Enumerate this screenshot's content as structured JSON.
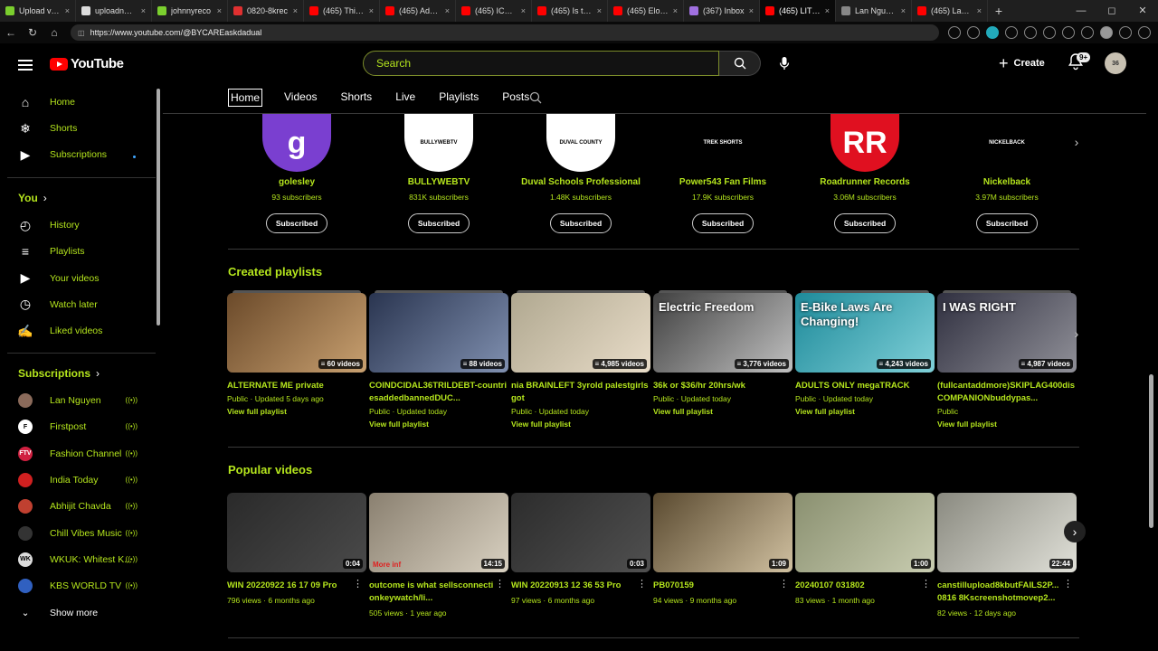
{
  "browser": {
    "tabs": [
      {
        "label": "Upload vide",
        "color": "#7bcf2e"
      },
      {
        "label": "uploadnow-l",
        "color": "#dddddd"
      },
      {
        "label": "johnnyreco",
        "color": "#7bcf2e"
      },
      {
        "label": "0820-8krec",
        "color": "#e03030"
      },
      {
        "label": "(465) This is",
        "color": "#ff0000"
      },
      {
        "label": "(465) Adora",
        "color": "#ff0000"
      },
      {
        "label": "(465) ICE car",
        "color": "#ff0000"
      },
      {
        "label": "(465) Is this",
        "color": "#ff0000"
      },
      {
        "label": "(465) Elon M",
        "color": "#ff0000"
      },
      {
        "label": "(367) Inbox",
        "color": "#a070e0"
      },
      {
        "label": "(465) LITHIU",
        "color": "#ff0000"
      },
      {
        "label": "Lan Nguyen",
        "color": "#888888"
      },
      {
        "label": "(465) Lan Ng",
        "color": "#ff0000"
      }
    ],
    "new_tab": "+",
    "url": "https://www.youtube.com/@BYCAREaskdadual"
  },
  "header": {
    "logo_text": "YouTube",
    "search_placeholder": "Search",
    "create_label": "Create",
    "notifications_badge": "9+",
    "avatar_text": "36"
  },
  "sidebar": {
    "main": [
      {
        "label": "Home",
        "icon": "home-icon"
      },
      {
        "label": "Shorts",
        "icon": "shorts-icon"
      },
      {
        "label": "Subscriptions",
        "icon": "subscriptions-icon"
      }
    ],
    "you_title": "You",
    "you_items": [
      {
        "label": "History",
        "icon": "history-icon"
      },
      {
        "label": "Playlists",
        "icon": "playlists-icon"
      },
      {
        "label": "Your videos",
        "icon": "your-videos-icon"
      },
      {
        "label": "Watch later",
        "icon": "watch-later-icon"
      },
      {
        "label": "Liked videos",
        "icon": "liked-icon"
      }
    ],
    "subscriptions_title": "Subscriptions",
    "subscriptions": [
      {
        "label": "Lan Nguyen",
        "color": "#8a6a5a",
        "initial": ""
      },
      {
        "label": "Firstpost",
        "color": "#ffffff",
        "initial": "F"
      },
      {
        "label": "Fashion Channel",
        "color": "#d02040",
        "initial": "FTV"
      },
      {
        "label": "India Today",
        "color": "#d02020",
        "initial": ""
      },
      {
        "label": "Abhijit Chavda",
        "color": "#c04030",
        "initial": ""
      },
      {
        "label": "Chill Vibes Music",
        "color": "#333333",
        "initial": ""
      },
      {
        "label": "WKUK: Whitest K...",
        "color": "#dddddd",
        "initial": "WK"
      },
      {
        "label": "KBS WORLD TV",
        "color": "#3060c0",
        "initial": ""
      }
    ],
    "show_more": "Show more"
  },
  "channel_tabs": [
    "Home",
    "Videos",
    "Shorts",
    "Live",
    "Playlists",
    "Posts"
  ],
  "channels": [
    {
      "name": "golesley",
      "subs": "93 subscribers",
      "btn": "Subscribed",
      "avatar_text": "g",
      "color": "#7a3fd0"
    },
    {
      "name": "BULLYWEBTV",
      "subs": "831K subscribers",
      "btn": "Subscribed",
      "avatar_text": "BULLYWEBTV",
      "color": "#ffffff"
    },
    {
      "name": "Duval Schools Professional",
      "subs": "1.48K subscribers",
      "btn": "Subscribed",
      "avatar_text": "DUVAL COUNTY",
      "color": "#ffffff"
    },
    {
      "name": "Power543 Fan Films",
      "subs": "17.9K subscribers",
      "btn": "Subscribed",
      "avatar_text": "TREK SHORTS",
      "color": "#000000"
    },
    {
      "name": "Roadrunner Records",
      "subs": "3.06M subscribers",
      "btn": "Subscribed",
      "avatar_text": "RR",
      "color": "#e01020"
    },
    {
      "name": "Nickelback",
      "subs": "3.97M subscribers",
      "btn": "Subscribed",
      "avatar_text": "NICKELBACK",
      "color": "#000000"
    }
  ],
  "created_playlists_title": "Created playlists",
  "playlists": [
    {
      "title": "ALTERNATE ME private",
      "meta": "Public · Updated 5 days ago",
      "count": "60 videos",
      "link": "View full playlist",
      "c1": "#6b4a2a",
      "c2": "#c8a070"
    },
    {
      "title": "COINDCIDAL36TRILDEBT-countriesaddedbannedDUC...",
      "meta": "Public · Updated today",
      "count": "88 videos",
      "link": "View full playlist",
      "c1": "#2a3550",
      "c2": "#8090b0"
    },
    {
      "title": "nia BRAINLEFT 3yrold palestgirlsgot",
      "meta": "Public · Updated today",
      "count": "4,985 videos",
      "link": "View full playlist",
      "c1": "#b0a890",
      "c2": "#e8dcc8"
    },
    {
      "title": "36k or $36/hr 20hrs/wk",
      "meta": "Public · Updated today",
      "count": "3,776 videos",
      "link": "View full playlist",
      "c1": "#404040",
      "c2": "#c0c0c0",
      "overlay": "Electric Freedom"
    },
    {
      "title": "ADULTS ONLY megaTRACK",
      "meta": "Public · Updated today",
      "count": "4,243 videos",
      "link": "View full playlist",
      "c1": "#1e8a9a",
      "c2": "#7fd0d8",
      "overlay": "E-Bike Laws Are Changing!"
    },
    {
      "title": "(fullcantaddmore)SKIPLAG400disCOMPANIONbuddypas...",
      "meta": "Public",
      "count": "4,987 videos",
      "link": "View full playlist",
      "c1": "#303040",
      "c2": "#909098",
      "overlay": "I WAS RIGHT"
    }
  ],
  "popular_videos_title": "Popular videos",
  "videos": [
    {
      "title": "WIN 20220922 16 17 09 Pro",
      "meta": "796 views · 6 months ago",
      "dur": "0:04",
      "c1": "#2a2a2a",
      "c2": "#4a4a4a"
    },
    {
      "title": "outcome is what sellsconnectionkeywatch/li...",
      "meta": "505 views · 1 year ago",
      "dur": "14:15",
      "c1": "#8a8070",
      "c2": "#d8d0c0",
      "overlay": "More inf"
    },
    {
      "title": "WIN 20220913 12 36 53 Pro",
      "meta": "97 views · 6 months ago",
      "dur": "0:03",
      "c1": "#2c2c2c",
      "c2": "#505050"
    },
    {
      "title": "PB070159",
      "meta": "94 views · 9 months ago",
      "dur": "1:09",
      "c1": "#5a4a30",
      "c2": "#d0c0a0"
    },
    {
      "title": "20240107 031802",
      "meta": "83 views · 1 month ago",
      "dur": "1:00",
      "c1": "#8a9070",
      "c2": "#c8ccb0"
    },
    {
      "title": "canstillupload8kbutFAILS2P... 0816 8Kscreenshotmovep2...",
      "meta": "82 views · 12 days ago",
      "dur": "22:44",
      "c1": "#8a8a80",
      "c2": "#e0e0d8"
    }
  ]
}
